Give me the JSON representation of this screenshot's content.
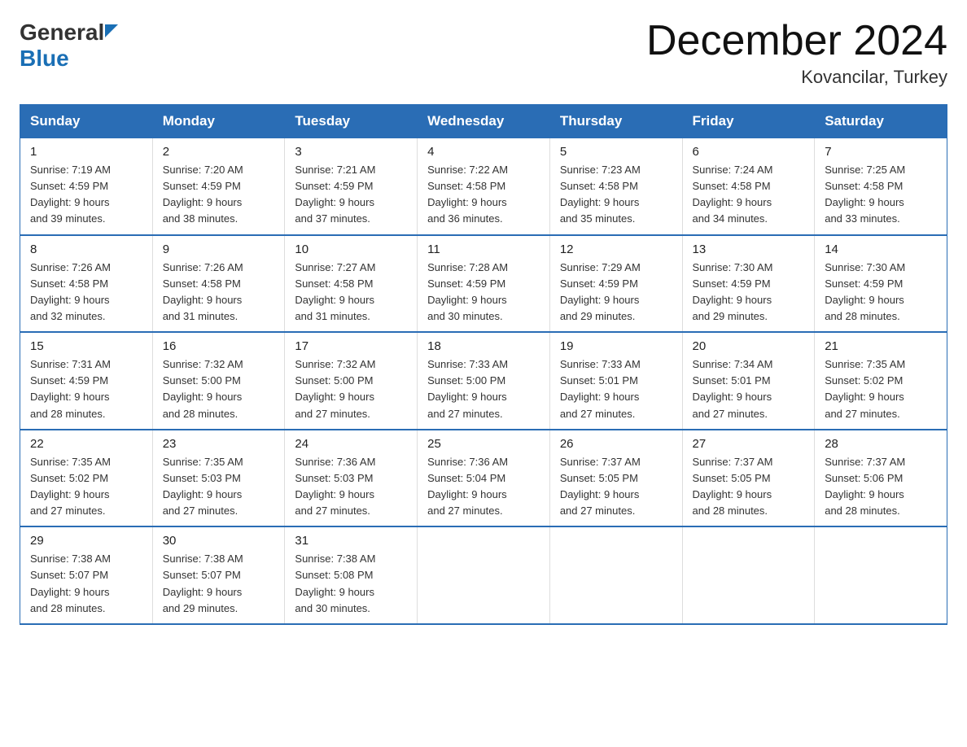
{
  "header": {
    "logo_general": "General",
    "logo_blue": "Blue",
    "month_title": "December 2024",
    "location": "Kovancilar, Turkey"
  },
  "days_header": [
    "Sunday",
    "Monday",
    "Tuesday",
    "Wednesday",
    "Thursday",
    "Friday",
    "Saturday"
  ],
  "weeks": [
    [
      {
        "day": "1",
        "info": "Sunrise: 7:19 AM\nSunset: 4:59 PM\nDaylight: 9 hours\nand 39 minutes."
      },
      {
        "day": "2",
        "info": "Sunrise: 7:20 AM\nSunset: 4:59 PM\nDaylight: 9 hours\nand 38 minutes."
      },
      {
        "day": "3",
        "info": "Sunrise: 7:21 AM\nSunset: 4:59 PM\nDaylight: 9 hours\nand 37 minutes."
      },
      {
        "day": "4",
        "info": "Sunrise: 7:22 AM\nSunset: 4:58 PM\nDaylight: 9 hours\nand 36 minutes."
      },
      {
        "day": "5",
        "info": "Sunrise: 7:23 AM\nSunset: 4:58 PM\nDaylight: 9 hours\nand 35 minutes."
      },
      {
        "day": "6",
        "info": "Sunrise: 7:24 AM\nSunset: 4:58 PM\nDaylight: 9 hours\nand 34 minutes."
      },
      {
        "day": "7",
        "info": "Sunrise: 7:25 AM\nSunset: 4:58 PM\nDaylight: 9 hours\nand 33 minutes."
      }
    ],
    [
      {
        "day": "8",
        "info": "Sunrise: 7:26 AM\nSunset: 4:58 PM\nDaylight: 9 hours\nand 32 minutes."
      },
      {
        "day": "9",
        "info": "Sunrise: 7:26 AM\nSunset: 4:58 PM\nDaylight: 9 hours\nand 31 minutes."
      },
      {
        "day": "10",
        "info": "Sunrise: 7:27 AM\nSunset: 4:58 PM\nDaylight: 9 hours\nand 31 minutes."
      },
      {
        "day": "11",
        "info": "Sunrise: 7:28 AM\nSunset: 4:59 PM\nDaylight: 9 hours\nand 30 minutes."
      },
      {
        "day": "12",
        "info": "Sunrise: 7:29 AM\nSunset: 4:59 PM\nDaylight: 9 hours\nand 29 minutes."
      },
      {
        "day": "13",
        "info": "Sunrise: 7:30 AM\nSunset: 4:59 PM\nDaylight: 9 hours\nand 29 minutes."
      },
      {
        "day": "14",
        "info": "Sunrise: 7:30 AM\nSunset: 4:59 PM\nDaylight: 9 hours\nand 28 minutes."
      }
    ],
    [
      {
        "day": "15",
        "info": "Sunrise: 7:31 AM\nSunset: 4:59 PM\nDaylight: 9 hours\nand 28 minutes."
      },
      {
        "day": "16",
        "info": "Sunrise: 7:32 AM\nSunset: 5:00 PM\nDaylight: 9 hours\nand 28 minutes."
      },
      {
        "day": "17",
        "info": "Sunrise: 7:32 AM\nSunset: 5:00 PM\nDaylight: 9 hours\nand 27 minutes."
      },
      {
        "day": "18",
        "info": "Sunrise: 7:33 AM\nSunset: 5:00 PM\nDaylight: 9 hours\nand 27 minutes."
      },
      {
        "day": "19",
        "info": "Sunrise: 7:33 AM\nSunset: 5:01 PM\nDaylight: 9 hours\nand 27 minutes."
      },
      {
        "day": "20",
        "info": "Sunrise: 7:34 AM\nSunset: 5:01 PM\nDaylight: 9 hours\nand 27 minutes."
      },
      {
        "day": "21",
        "info": "Sunrise: 7:35 AM\nSunset: 5:02 PM\nDaylight: 9 hours\nand 27 minutes."
      }
    ],
    [
      {
        "day": "22",
        "info": "Sunrise: 7:35 AM\nSunset: 5:02 PM\nDaylight: 9 hours\nand 27 minutes."
      },
      {
        "day": "23",
        "info": "Sunrise: 7:35 AM\nSunset: 5:03 PM\nDaylight: 9 hours\nand 27 minutes."
      },
      {
        "day": "24",
        "info": "Sunrise: 7:36 AM\nSunset: 5:03 PM\nDaylight: 9 hours\nand 27 minutes."
      },
      {
        "day": "25",
        "info": "Sunrise: 7:36 AM\nSunset: 5:04 PM\nDaylight: 9 hours\nand 27 minutes."
      },
      {
        "day": "26",
        "info": "Sunrise: 7:37 AM\nSunset: 5:05 PM\nDaylight: 9 hours\nand 27 minutes."
      },
      {
        "day": "27",
        "info": "Sunrise: 7:37 AM\nSunset: 5:05 PM\nDaylight: 9 hours\nand 28 minutes."
      },
      {
        "day": "28",
        "info": "Sunrise: 7:37 AM\nSunset: 5:06 PM\nDaylight: 9 hours\nand 28 minutes."
      }
    ],
    [
      {
        "day": "29",
        "info": "Sunrise: 7:38 AM\nSunset: 5:07 PM\nDaylight: 9 hours\nand 28 minutes."
      },
      {
        "day": "30",
        "info": "Sunrise: 7:38 AM\nSunset: 5:07 PM\nDaylight: 9 hours\nand 29 minutes."
      },
      {
        "day": "31",
        "info": "Sunrise: 7:38 AM\nSunset: 5:08 PM\nDaylight: 9 hours\nand 30 minutes."
      },
      {
        "day": "",
        "info": ""
      },
      {
        "day": "",
        "info": ""
      },
      {
        "day": "",
        "info": ""
      },
      {
        "day": "",
        "info": ""
      }
    ]
  ]
}
